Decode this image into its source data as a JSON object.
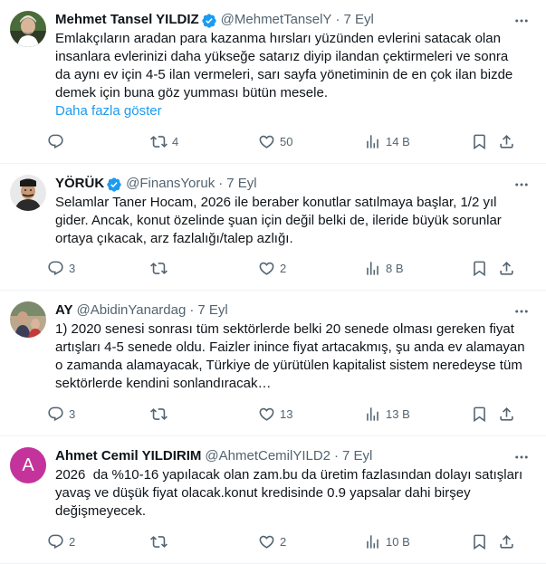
{
  "tweets": [
    {
      "name": "Mehmet Tansel YILDIZ",
      "verified": true,
      "handle": "@MehmetTanselY",
      "separator": "·",
      "time": "7 Eyl",
      "text": "Emlakçıların aradan para kazanma hırsları yüzünden evlerini satacak olan insanlara evlerinizi daha yükseğe satarız diyip ilandan çektirmeleri ve sonra da aynı ev için 4-5 ilan vermeleri, sarı sayfa yönetiminin de en çok ilan bizde demek için buna göz yumması bütün mesele.",
      "show_more": "Daha fazla göster",
      "replies": "",
      "reposts": "4",
      "likes": "50",
      "views": "14 B",
      "avatar": "photo"
    },
    {
      "name": "YÖRÜK",
      "verified": true,
      "handle": "@FinansYoruk",
      "separator": "·",
      "time": "7 Eyl",
      "text": "Selamlar Taner Hocam, 2026 ile beraber konutlar satılmaya başlar, 1/2 yıl gider. Ancak, konut özelinde şuan için değil belki de, ileride büyük sorunlar ortaya çıkacak, arz fazlalığı/talep azlığı.",
      "replies": "3",
      "reposts": "",
      "likes": "2",
      "views": "8 B",
      "avatar": "illustration"
    },
    {
      "name": "AY",
      "verified": false,
      "handle": "@AbidinYanardag",
      "separator": "·",
      "time": "7 Eyl",
      "text": "1) 2020 senesi sonrası tüm sektörlerde belki 20 senede olması gereken fiyat artışları 4-5 senede oldu. Faizler inince fiyat artacakmış, şu anda ev alamayan o zamanda alamayacak, Türkiye de yürütülen kapitalist sistem neredeyse tüm sektörlerde kendini sonlandıracak…",
      "replies": "3",
      "reposts": "",
      "likes": "13",
      "views": "13 B",
      "avatar": "photo"
    },
    {
      "name": "Ahmet Cemil YILDIRIM",
      "verified": false,
      "handle": "@AhmetCemilYILD2",
      "separator": "·",
      "time": "7 Eyl",
      "text": "2026  da %10-16 yapılacak olan zam.bu da üretim fazlasından dolayı satışları yavaş ve düşük fiyat olacak.konut kredisinde 0.9 yapsalar dahi birşey değişmeyecek.",
      "replies": "2",
      "reposts": "",
      "likes": "2",
      "views": "10 B",
      "avatar_letter": "A"
    }
  ],
  "colors": {
    "text": "#0f1419",
    "secondary": "#536471",
    "link": "#1d9bf0",
    "verified": "#1d9bf0",
    "divider": "#eff3f4",
    "avatar_letter_bg": "#c4339b"
  },
  "icons": [
    "more-icon",
    "reply-icon",
    "repost-icon",
    "like-icon",
    "views-icon",
    "bookmark-icon",
    "share-icon",
    "verified-badge-icon"
  ]
}
